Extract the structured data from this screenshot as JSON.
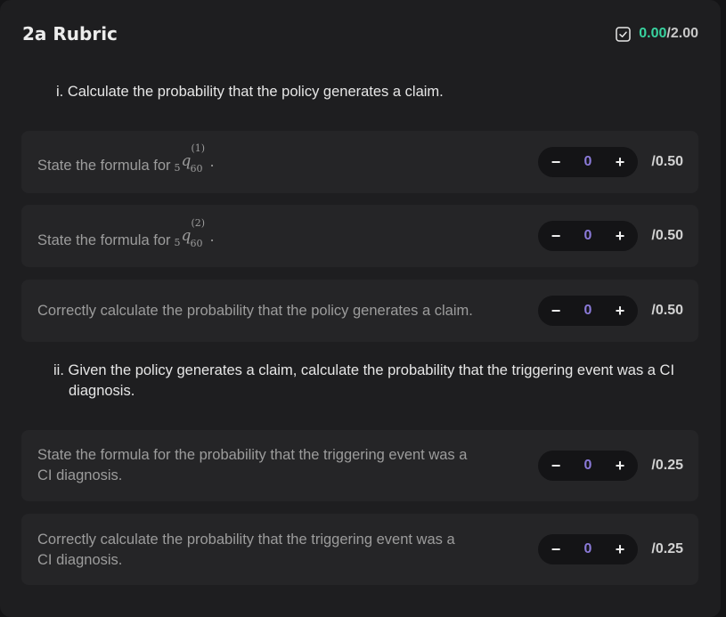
{
  "header": {
    "title": "2a Rubric",
    "score_earned": "0.00",
    "score_total": "/2.00",
    "icon": "checkbox-check-icon",
    "colors": {
      "earned": "#38d39f",
      "value": "#8b7ad9"
    }
  },
  "sections": [
    {
      "heading": "i. Calculate the probability that the policy generates a claim.",
      "items": [
        {
          "text": "State the formula for",
          "math": {
            "pre": "5",
            "base": "q",
            "sub": "60",
            "sup": "(1)"
          },
          "value": "0",
          "max": "/0.50",
          "minus": "−",
          "plus": "+"
        },
        {
          "text": "State the formula for",
          "math": {
            "pre": "5",
            "base": "q",
            "sub": "60",
            "sup": "(2)"
          },
          "value": "0",
          "max": "/0.50",
          "minus": "−",
          "plus": "+"
        },
        {
          "text": "Correctly calculate the probability that the policy generates a claim.",
          "value": "0",
          "max": "/0.50",
          "minus": "−",
          "plus": "+"
        }
      ]
    },
    {
      "heading": "ii. Given the policy generates a claim, calculate the probability that the triggering event was a CI diagnosis.",
      "items": [
        {
          "text_line1": "State the formula for the probability that the triggering event was a",
          "text_line2": "CI diagnosis.",
          "value": "0",
          "max": "/0.25",
          "minus": "−",
          "plus": "+"
        },
        {
          "text_line1": "Correctly calculate the probability that the triggering event was a",
          "text_line2": "CI diagnosis.",
          "value": "0",
          "max": "/0.25",
          "minus": "−",
          "plus": "+"
        }
      ]
    }
  ]
}
